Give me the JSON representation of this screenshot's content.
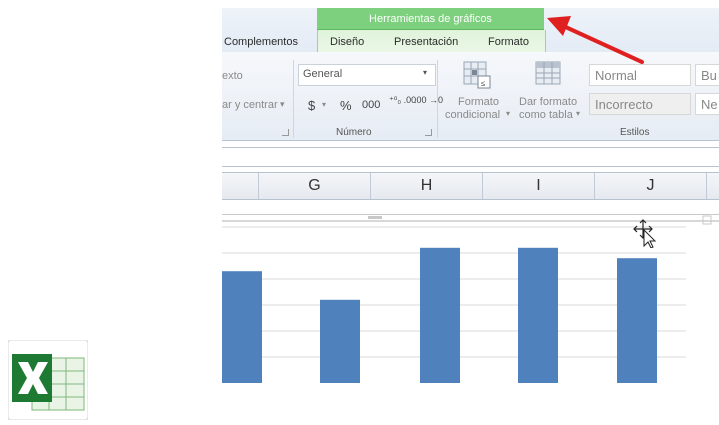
{
  "ribbon": {
    "contextual_group": "Herramientas de gráficos",
    "tabs": [
      {
        "label": "Complementos"
      },
      {
        "label": "Diseño"
      },
      {
        "label": "Presentación"
      },
      {
        "label": "Formato"
      }
    ],
    "alignment": {
      "wrap_text": "exto",
      "merge_center": "ar y centrar"
    },
    "number": {
      "format_value": "General",
      "currency": "$",
      "percent": "%",
      "thousands": "000",
      "dec_increase": "⁺⁰₀ .00",
      "dec_decrease": ".00 →0",
      "group_label": "Número"
    },
    "styles": {
      "cond_format_line1": "Formato",
      "cond_format_line2": "condicional",
      "table_format_line1": "Dar formato",
      "table_format_line2": "como tabla",
      "cell_styles": [
        "Normal",
        "Bu",
        "Incorrecto",
        "Ne"
      ],
      "group_label": "Estilos"
    }
  },
  "columns": [
    "G",
    "H",
    "I",
    "J"
  ],
  "chart_data": {
    "type": "bar",
    "categories": [
      "",
      "",
      "",
      "",
      ""
    ],
    "values": [
      4.3,
      3.2,
      5.2,
      5.2,
      4.8
    ],
    "ylim": [
      0,
      6
    ],
    "grid": true,
    "bar_color": "#4f81bd"
  },
  "colors": {
    "contextual_tab": "#7dd07d",
    "arrow": "#e02020",
    "excel_green": "#1e7a33"
  }
}
